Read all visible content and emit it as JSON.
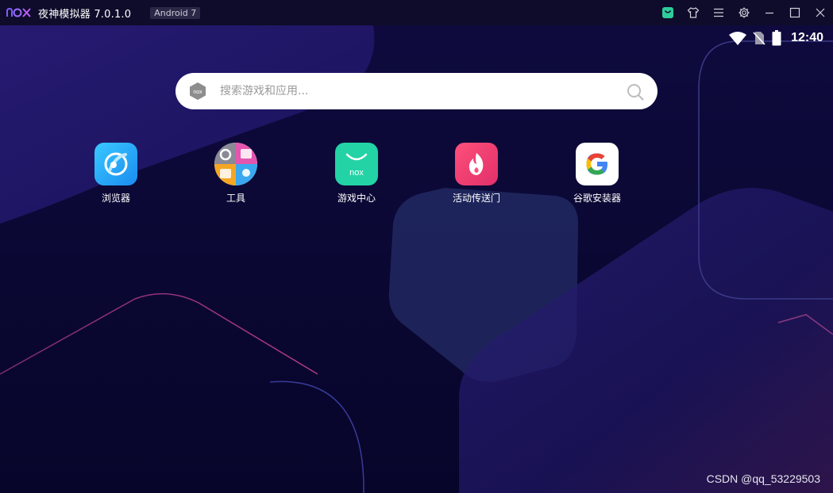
{
  "window": {
    "title": "夜神模拟器 7.0.1.0",
    "android_badge": "Android 7",
    "brand_color": "#7b5cff",
    "controls": [
      "store-icon",
      "theme-icon",
      "menu-icon",
      "settings-icon",
      "minimize-icon",
      "maximize-icon",
      "close-icon"
    ]
  },
  "status_bar": {
    "time": "12:40",
    "icons": [
      "wifi-icon",
      "no-sim-icon",
      "battery-icon"
    ]
  },
  "search": {
    "placeholder": "搜索游戏和应用..."
  },
  "apps": [
    {
      "label": "浏览器",
      "icon": "browser-icon"
    },
    {
      "label": "工具",
      "icon": "tools-icon"
    },
    {
      "label": "游戏中心",
      "icon": "game-center-icon"
    },
    {
      "label": "活动传送门",
      "icon": "event-portal-icon"
    },
    {
      "label": "谷歌安装器",
      "icon": "google-installer-icon"
    }
  ],
  "watermark": "CSDN @qq_53229503"
}
